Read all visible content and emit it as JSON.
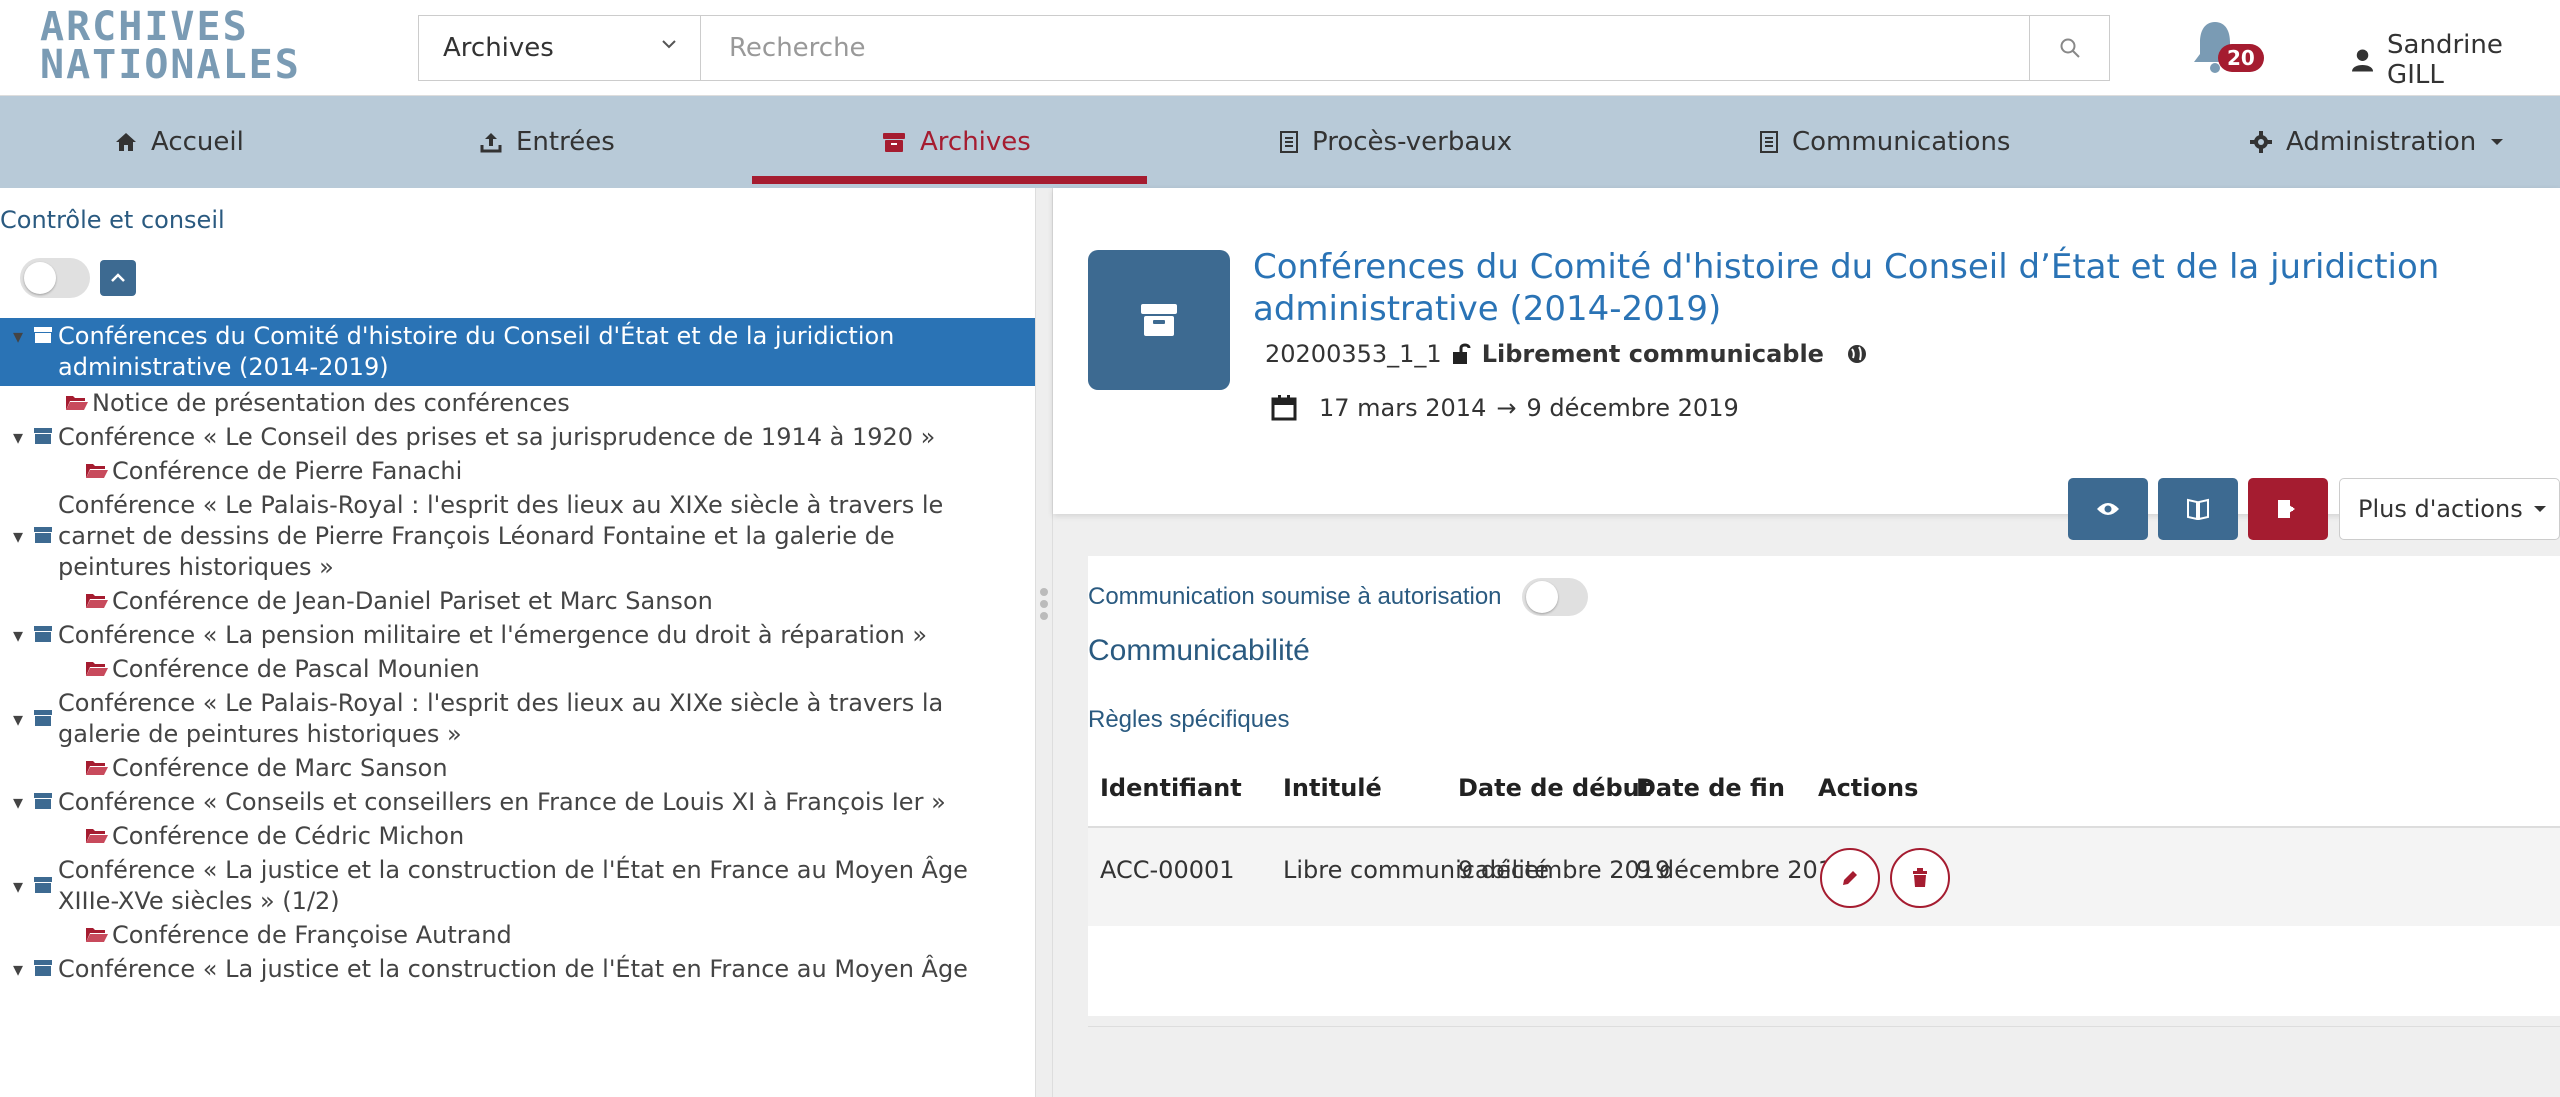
{
  "app": {
    "logo_line1": "ARCHIVES",
    "logo_line2": "NATIONALES"
  },
  "search": {
    "scope_value": "Archives",
    "placeholder": "Recherche"
  },
  "notifications": {
    "count": "20"
  },
  "user": {
    "name": "Sandrine GILL"
  },
  "nav": {
    "items": [
      {
        "label": "Accueil"
      },
      {
        "label": "Entrées"
      },
      {
        "label": "Archives"
      },
      {
        "label": "Procès-verbaux"
      },
      {
        "label": "Communications"
      },
      {
        "label": "Administration"
      }
    ]
  },
  "tree": {
    "title": "Contrôle et conseil",
    "nodes": [
      {
        "label": "Conférences du Comité d'histoire du Conseil d'État et de la juridiction administrative (2014-2019)"
      },
      {
        "label": "Notice de présentation des conférences"
      },
      {
        "label": "Conférence « Le Conseil des prises et sa jurisprudence de 1914 à 1920 »"
      },
      {
        "label": "Conférence de Pierre Fanachi"
      },
      {
        "label": "Conférence « Le Palais-Royal : l'esprit des lieux au XIXe siècle à travers le carnet de dessins de Pierre François Léonard Fontaine et la galerie de peintures historiques »"
      },
      {
        "label": "Conférence de Jean-Daniel Pariset et Marc Sanson"
      },
      {
        "label": "Conférence « La pension militaire et l'émergence du droit à réparation »"
      },
      {
        "label": "Conférence de Pascal Mounien"
      },
      {
        "label": "Conférence « Le Palais-Royal : l'esprit des lieux au XIXe siècle à travers la galerie de peintures historiques »"
      },
      {
        "label": "Conférence de Marc Sanson"
      },
      {
        "label": "Conférence « Conseils et conseillers en France de Louis XI à François Ier »"
      },
      {
        "label": "Conférence de Cédric Michon"
      },
      {
        "label": "Conférence « La justice et la construction de l'État en France au Moyen Âge XIIIe-XVe siècles » (1/2)"
      },
      {
        "label": "Conférence de Françoise Autrand"
      },
      {
        "label": "Conférence « La justice et la construction de l'État en France au Moyen Âge"
      }
    ]
  },
  "record": {
    "title": "Conférences du Comité d'histoire du Conseil d’État et de la juridiction administrative (2014-2019)",
    "reference": "20200353_1_1",
    "access_status": "Librement communicable",
    "date_start": "17 mars 2014",
    "date_arrow": "→",
    "date_end": "9 décembre 2019",
    "more_actions": "Plus d'actions"
  },
  "communication": {
    "authorization_label": "Communication soumise à autorisation",
    "heading": "Communicabilité",
    "rules_label": "Règles spécifiques",
    "columns": [
      "Identifiant",
      "Intitulé",
      "Date de début",
      "Date de fin",
      "Actions"
    ],
    "rows": [
      {
        "id": "ACC-00001",
        "title": "Libre communicabilité",
        "start": "9 décembre 2019",
        "end": "9 décembre 2019"
      }
    ]
  },
  "colors": {
    "accent": "#a51c30",
    "primary": "#3d6a91",
    "nav_bg": "#b8cad8",
    "selected": "#2a73b5"
  }
}
